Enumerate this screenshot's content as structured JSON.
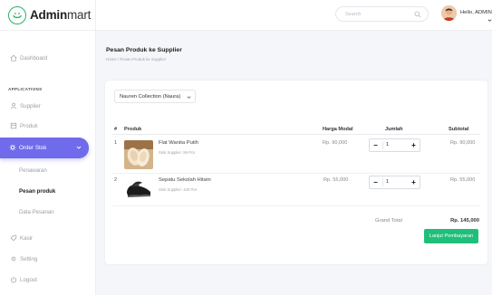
{
  "brand": {
    "bold": "Admin",
    "light": "mart"
  },
  "topbar": {
    "search_placeholder": "Search",
    "user_greeting": "Hello, ADMIN"
  },
  "sidebar": {
    "dashboard": "Dashboard",
    "section_label": "APPLICATIONS",
    "supplier": "Supplier",
    "produk": "Produk",
    "order_stok": "Order Stok",
    "sub_items": [
      "Penawaran",
      "Pesan produk",
      "Data Pesanan"
    ],
    "kasir": "Kasir",
    "setting": "Setting",
    "logout": "Logout"
  },
  "page": {
    "title": "Pesan Produk ke Supplier",
    "breadcrumb": "Home  /  Pesan Produk ke Supplier"
  },
  "supplier_select": {
    "value": "Nauren Collection (Naura)"
  },
  "table": {
    "headers": {
      "no": "#",
      "product": "Produk",
      "price": "Harga Modal",
      "qty": "Jumlah",
      "subtotal": "Subtotal"
    },
    "rows": [
      {
        "no": "1",
        "name": "Flat Wanita Putih",
        "stock": "Stok Supplier: 99 Pcs",
        "price": "Rp. 90,000",
        "qty": "1",
        "subtotal": "Rp. 90,000"
      },
      {
        "no": "2",
        "name": "Sepatu Sekolah Hitam",
        "stock": "Stok Supplier: 440 Pcs",
        "price": "Rp. 55,000",
        "qty": "1",
        "subtotal": "Rp. 55,000"
      }
    ],
    "stepper": {
      "minus": "−",
      "plus": "+"
    }
  },
  "totals": {
    "label": "Grand Total",
    "value": "Rp. 145,000"
  },
  "pay_button": "Lanjut Pembayaran",
  "colors": {
    "accent": "#6f6bea",
    "brand_green": "#27b36a",
    "pay_green": "#1fbf7a"
  }
}
